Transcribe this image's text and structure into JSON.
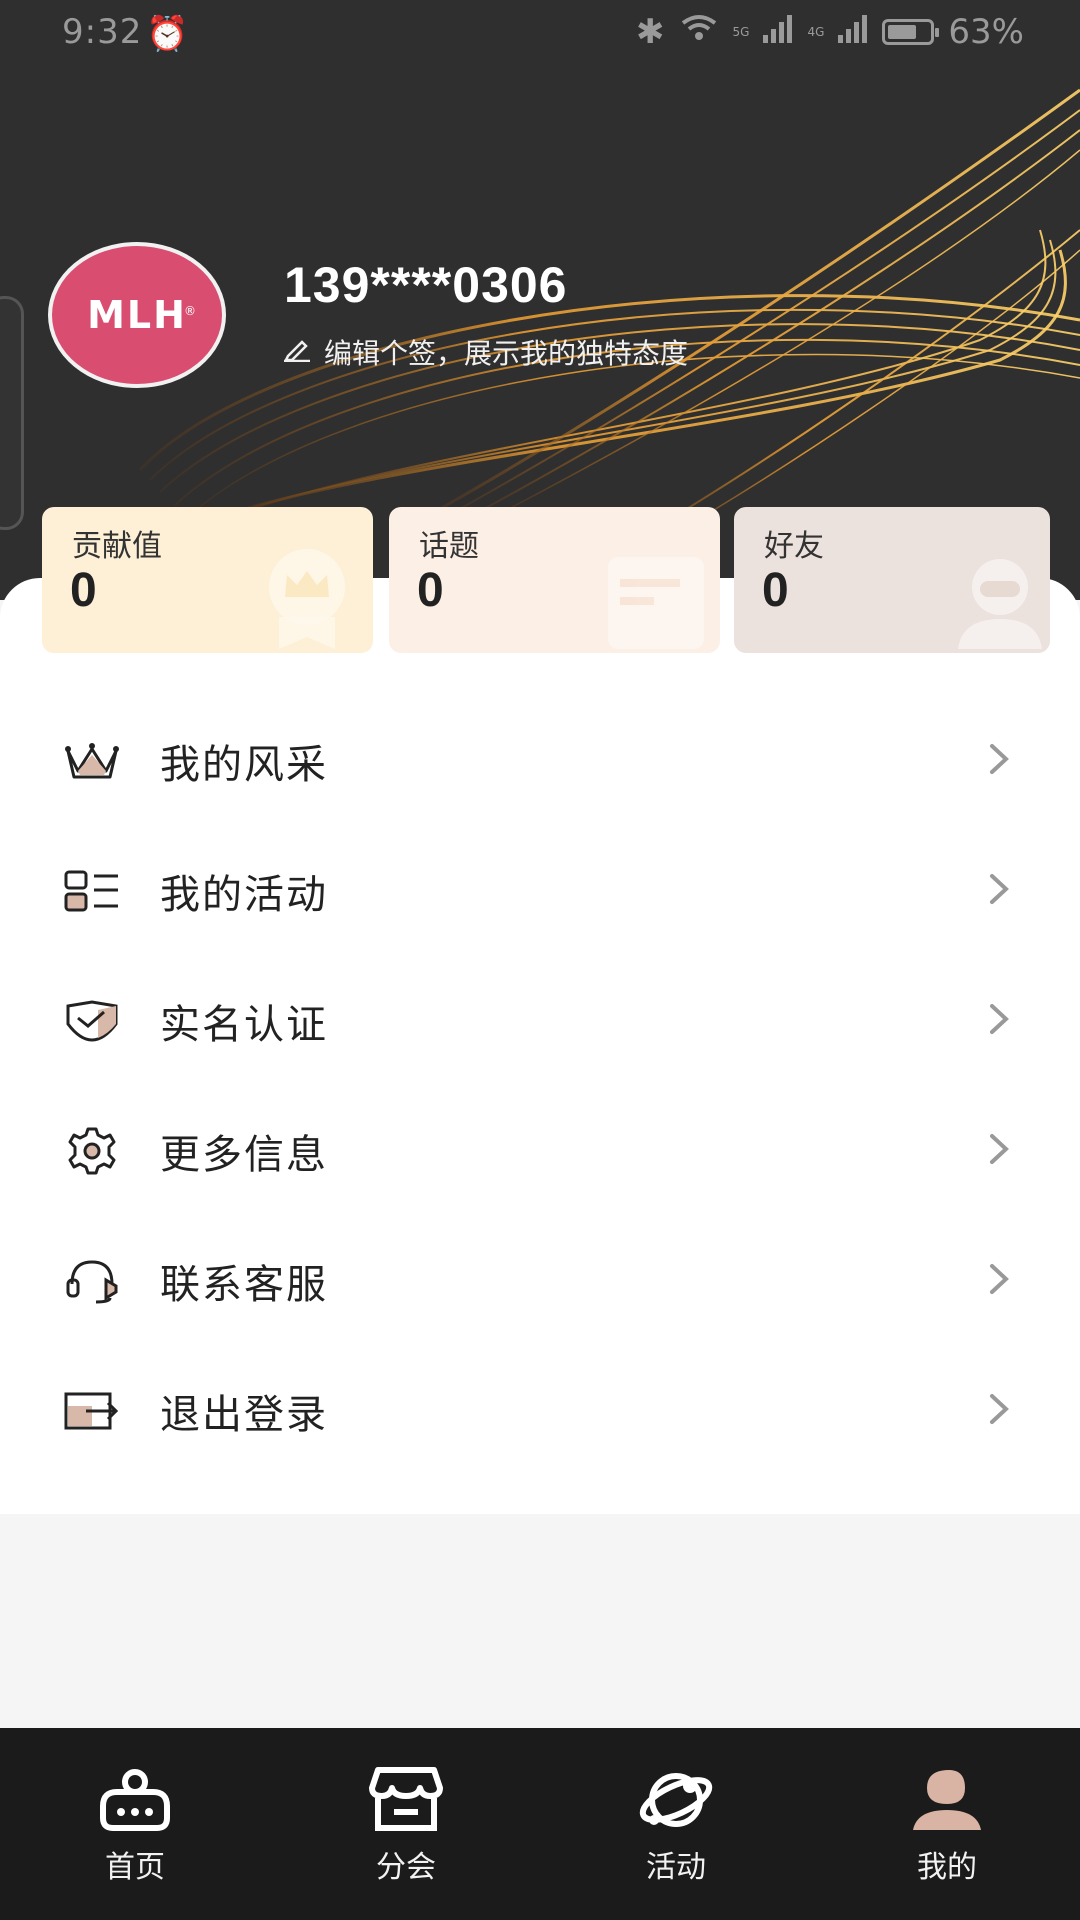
{
  "status_bar": {
    "time": "9:32",
    "battery": "63%",
    "network_1": "5G",
    "network_2": "4G"
  },
  "profile": {
    "avatar_logo": "MLH",
    "avatar_reg_mark": "®",
    "username": "139****0306",
    "signature": "编辑个签，展示我的独特态度"
  },
  "stats": [
    {
      "label": "贡献值",
      "value": "0"
    },
    {
      "label": "话题",
      "value": "0"
    },
    {
      "label": "好友",
      "value": "0"
    }
  ],
  "menu": [
    {
      "label": "我的风采",
      "icon": "crown-icon"
    },
    {
      "label": "我的活动",
      "icon": "list-icon"
    },
    {
      "label": "实名认证",
      "icon": "shield-check-icon"
    },
    {
      "label": "更多信息",
      "icon": "gear-icon"
    },
    {
      "label": "联系客服",
      "icon": "headset-icon"
    },
    {
      "label": "退出登录",
      "icon": "logout-icon"
    }
  ],
  "bottom_nav": [
    {
      "label": "首页",
      "icon": "home-icon"
    },
    {
      "label": "分会",
      "icon": "store-icon"
    },
    {
      "label": "活动",
      "icon": "planet-icon"
    },
    {
      "label": "我的",
      "icon": "user-icon",
      "active": true
    }
  ],
  "colors": {
    "banner_bg": "#2f2f30",
    "avatar_bg": "#d94e70",
    "accent_gold": "#e0a040",
    "nav_bg": "#1b1b1b"
  }
}
